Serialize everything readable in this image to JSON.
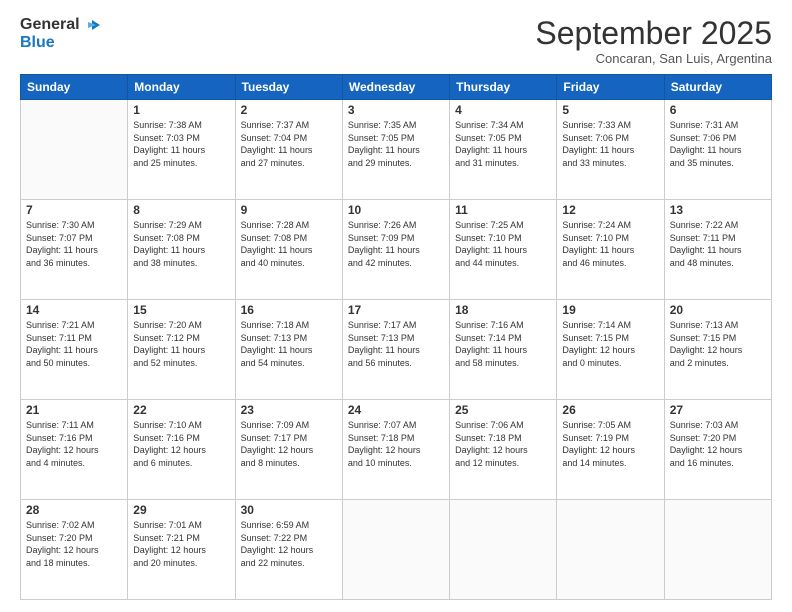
{
  "logo": {
    "line1": "General",
    "line2": "Blue"
  },
  "title": "September 2025",
  "subtitle": "Concaran, San Luis, Argentina",
  "days_of_week": [
    "Sunday",
    "Monday",
    "Tuesday",
    "Wednesday",
    "Thursday",
    "Friday",
    "Saturday"
  ],
  "weeks": [
    [
      {
        "day": "",
        "info": ""
      },
      {
        "day": "1",
        "info": "Sunrise: 7:38 AM\nSunset: 7:03 PM\nDaylight: 11 hours\nand 25 minutes."
      },
      {
        "day": "2",
        "info": "Sunrise: 7:37 AM\nSunset: 7:04 PM\nDaylight: 11 hours\nand 27 minutes."
      },
      {
        "day": "3",
        "info": "Sunrise: 7:35 AM\nSunset: 7:05 PM\nDaylight: 11 hours\nand 29 minutes."
      },
      {
        "day": "4",
        "info": "Sunrise: 7:34 AM\nSunset: 7:05 PM\nDaylight: 11 hours\nand 31 minutes."
      },
      {
        "day": "5",
        "info": "Sunrise: 7:33 AM\nSunset: 7:06 PM\nDaylight: 11 hours\nand 33 minutes."
      },
      {
        "day": "6",
        "info": "Sunrise: 7:31 AM\nSunset: 7:06 PM\nDaylight: 11 hours\nand 35 minutes."
      }
    ],
    [
      {
        "day": "7",
        "info": "Sunrise: 7:30 AM\nSunset: 7:07 PM\nDaylight: 11 hours\nand 36 minutes."
      },
      {
        "day": "8",
        "info": "Sunrise: 7:29 AM\nSunset: 7:08 PM\nDaylight: 11 hours\nand 38 minutes."
      },
      {
        "day": "9",
        "info": "Sunrise: 7:28 AM\nSunset: 7:08 PM\nDaylight: 11 hours\nand 40 minutes."
      },
      {
        "day": "10",
        "info": "Sunrise: 7:26 AM\nSunset: 7:09 PM\nDaylight: 11 hours\nand 42 minutes."
      },
      {
        "day": "11",
        "info": "Sunrise: 7:25 AM\nSunset: 7:10 PM\nDaylight: 11 hours\nand 44 minutes."
      },
      {
        "day": "12",
        "info": "Sunrise: 7:24 AM\nSunset: 7:10 PM\nDaylight: 11 hours\nand 46 minutes."
      },
      {
        "day": "13",
        "info": "Sunrise: 7:22 AM\nSunset: 7:11 PM\nDaylight: 11 hours\nand 48 minutes."
      }
    ],
    [
      {
        "day": "14",
        "info": "Sunrise: 7:21 AM\nSunset: 7:11 PM\nDaylight: 11 hours\nand 50 minutes."
      },
      {
        "day": "15",
        "info": "Sunrise: 7:20 AM\nSunset: 7:12 PM\nDaylight: 11 hours\nand 52 minutes."
      },
      {
        "day": "16",
        "info": "Sunrise: 7:18 AM\nSunset: 7:13 PM\nDaylight: 11 hours\nand 54 minutes."
      },
      {
        "day": "17",
        "info": "Sunrise: 7:17 AM\nSunset: 7:13 PM\nDaylight: 11 hours\nand 56 minutes."
      },
      {
        "day": "18",
        "info": "Sunrise: 7:16 AM\nSunset: 7:14 PM\nDaylight: 11 hours\nand 58 minutes."
      },
      {
        "day": "19",
        "info": "Sunrise: 7:14 AM\nSunset: 7:15 PM\nDaylight: 12 hours\nand 0 minutes."
      },
      {
        "day": "20",
        "info": "Sunrise: 7:13 AM\nSunset: 7:15 PM\nDaylight: 12 hours\nand 2 minutes."
      }
    ],
    [
      {
        "day": "21",
        "info": "Sunrise: 7:11 AM\nSunset: 7:16 PM\nDaylight: 12 hours\nand 4 minutes."
      },
      {
        "day": "22",
        "info": "Sunrise: 7:10 AM\nSunset: 7:16 PM\nDaylight: 12 hours\nand 6 minutes."
      },
      {
        "day": "23",
        "info": "Sunrise: 7:09 AM\nSunset: 7:17 PM\nDaylight: 12 hours\nand 8 minutes."
      },
      {
        "day": "24",
        "info": "Sunrise: 7:07 AM\nSunset: 7:18 PM\nDaylight: 12 hours\nand 10 minutes."
      },
      {
        "day": "25",
        "info": "Sunrise: 7:06 AM\nSunset: 7:18 PM\nDaylight: 12 hours\nand 12 minutes."
      },
      {
        "day": "26",
        "info": "Sunrise: 7:05 AM\nSunset: 7:19 PM\nDaylight: 12 hours\nand 14 minutes."
      },
      {
        "day": "27",
        "info": "Sunrise: 7:03 AM\nSunset: 7:20 PM\nDaylight: 12 hours\nand 16 minutes."
      }
    ],
    [
      {
        "day": "28",
        "info": "Sunrise: 7:02 AM\nSunset: 7:20 PM\nDaylight: 12 hours\nand 18 minutes."
      },
      {
        "day": "29",
        "info": "Sunrise: 7:01 AM\nSunset: 7:21 PM\nDaylight: 12 hours\nand 20 minutes."
      },
      {
        "day": "30",
        "info": "Sunrise: 6:59 AM\nSunset: 7:22 PM\nDaylight: 12 hours\nand 22 minutes."
      },
      {
        "day": "",
        "info": ""
      },
      {
        "day": "",
        "info": ""
      },
      {
        "day": "",
        "info": ""
      },
      {
        "day": "",
        "info": ""
      }
    ]
  ]
}
